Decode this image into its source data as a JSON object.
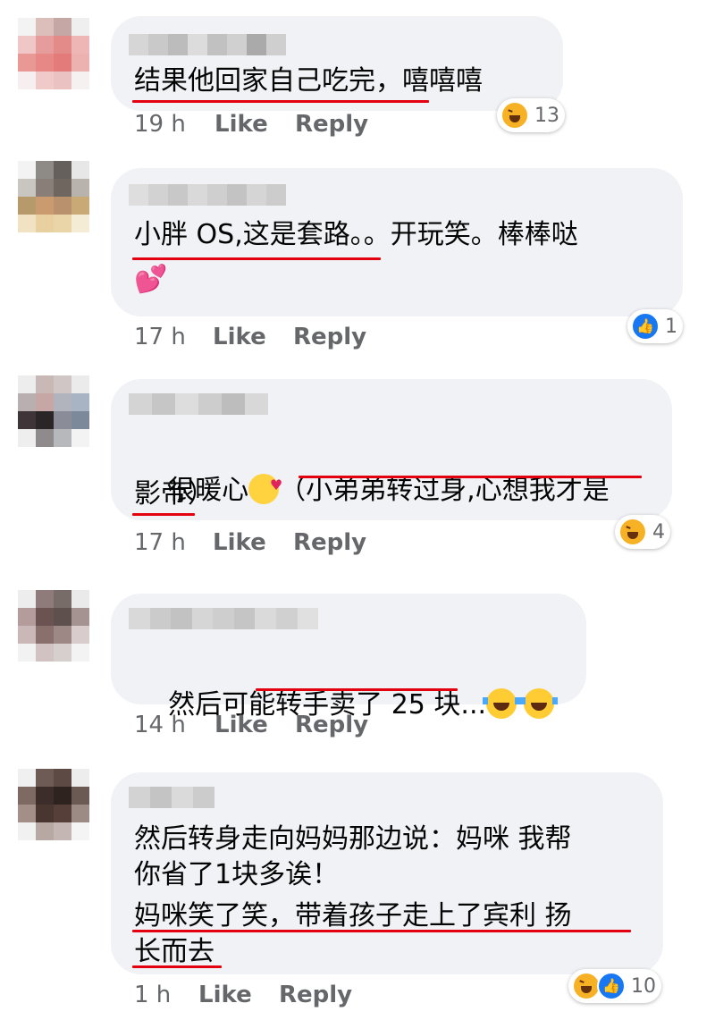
{
  "comments": [
    {
      "lines": [
        "结果他回家自己吃完，嘻嘻嘻"
      ],
      "time": "19 h",
      "like": "Like",
      "reply": "Reply",
      "reactions": [
        {
          "type": "haha"
        }
      ],
      "reaction_count": "13"
    },
    {
      "lines": [
        "小胖 OS,这是套路。。开玩笑。棒棒哒",
        ""
      ],
      "extra_emoji": "💕",
      "time": "17 h",
      "like": "Like",
      "reply": "Reply",
      "reactions": [
        {
          "type": "like"
        }
      ],
      "reaction_count": "1"
    },
    {
      "line1_pre": "很暖心",
      "line1_post": "（小弟弟转过身,心想我才是",
      "line2": "影帝）",
      "time": "17 h",
      "like": "Like",
      "reply": "Reply",
      "reactions": [
        {
          "type": "haha"
        }
      ],
      "reaction_count": "4"
    },
    {
      "line1": "然后可能转手卖了 25 块...",
      "time": "14 h",
      "like": "Like",
      "reply": "Reply"
    },
    {
      "lines": [
        "然后转身走向妈妈那边说：妈咪 我帮",
        "你省了1块多诶！",
        "妈咪笑了笑，带着孩子走上了宾利 扬",
        "长而去"
      ],
      "time": "1 h",
      "like": "Like",
      "reply": "Reply",
      "reactions": [
        {
          "type": "haha"
        },
        {
          "type": "like"
        }
      ],
      "reaction_count": "10"
    }
  ],
  "colors": {
    "bubble": "#f0f2f5",
    "underline": "#e3000f",
    "meta": "#65676b",
    "haha": "#f7b125",
    "like": "#1877f2"
  }
}
